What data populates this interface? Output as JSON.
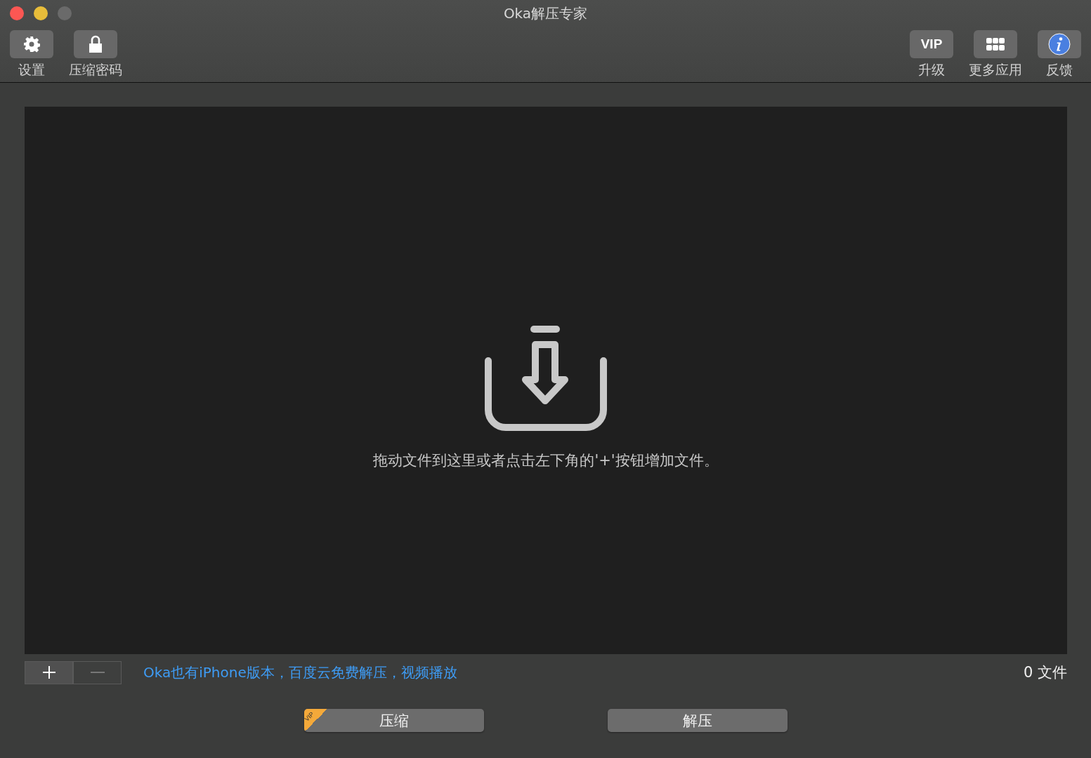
{
  "window": {
    "title": "Oka解压专家"
  },
  "toolbar_left": [
    {
      "kind": "gear",
      "label": "设置"
    },
    {
      "kind": "lock",
      "label": "压缩密码"
    }
  ],
  "toolbar_right": [
    {
      "kind": "vip",
      "text": "VIP",
      "label": "升级"
    },
    {
      "kind": "grid",
      "label": "更多应用"
    },
    {
      "kind": "info",
      "label": "反馈"
    }
  ],
  "drop_area": {
    "hint": "拖动文件到这里或者点击左下角的'+'按钮增加文件。"
  },
  "file_buttons": [
    {
      "kind": "add",
      "disabled": false
    },
    {
      "kind": "remove",
      "disabled": true
    }
  ],
  "promo_link": "Oka也有iPhone版本，百度云免费解压，视频播放",
  "file_count": "0 文件",
  "actions": [
    {
      "label": "压缩",
      "badge": "VIP"
    },
    {
      "label": "解压"
    }
  ]
}
